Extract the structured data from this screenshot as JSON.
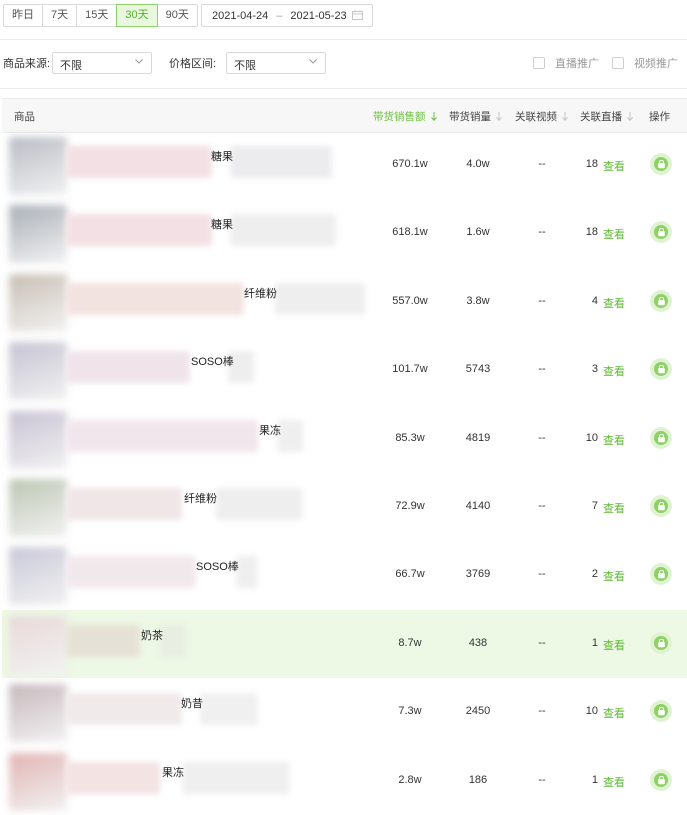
{
  "date_range": {
    "presets": [
      "昨日",
      "7天",
      "15天",
      "30天",
      "90天"
    ],
    "active_preset": "30天",
    "start": "2021-04-24",
    "separator": "–",
    "end": "2021-05-23"
  },
  "filters": {
    "source_label": "商品来源:",
    "source_value": "不限",
    "price_label": "价格区间:",
    "price_value": "不限",
    "live_promo": "直播推广",
    "video_promo": "视频推广"
  },
  "table": {
    "headers": {
      "product": "商品",
      "sales_amount": "带货销售额",
      "sales_volume": "带货销量",
      "related_videos": "关联视频",
      "related_live": "关联直播",
      "action": "操作"
    },
    "view_label": "查看",
    "rows": [
      {
        "keyword": "糖果",
        "sales_amount": "670.1w",
        "sales_volume": "4.0w",
        "related_videos": "--",
        "live_count": "18"
      },
      {
        "keyword": "糖果",
        "sales_amount": "618.1w",
        "sales_volume": "1.6w",
        "related_videos": "--",
        "live_count": "18"
      },
      {
        "keyword": "纤维粉",
        "sales_amount": "557.0w",
        "sales_volume": "3.8w",
        "related_videos": "--",
        "live_count": "4"
      },
      {
        "keyword": "SOSO棒",
        "sales_amount": "101.7w",
        "sales_volume": "5743",
        "related_videos": "--",
        "live_count": "3"
      },
      {
        "keyword": "果冻",
        "sales_amount": "85.3w",
        "sales_volume": "4819",
        "related_videos": "--",
        "live_count": "10"
      },
      {
        "keyword": "纤维粉",
        "sales_amount": "72.9w",
        "sales_volume": "4140",
        "related_videos": "--",
        "live_count": "7"
      },
      {
        "keyword": "SOSO棒",
        "sales_amount": "66.7w",
        "sales_volume": "3769",
        "related_videos": "--",
        "live_count": "2"
      },
      {
        "keyword": "奶茶",
        "sales_amount": "8.7w",
        "sales_volume": "438",
        "related_videos": "--",
        "live_count": "1"
      },
      {
        "keyword": "奶昔",
        "sales_amount": "7.3w",
        "sales_volume": "2450",
        "related_videos": "--",
        "live_count": "10"
      },
      {
        "keyword": "果冻",
        "sales_amount": "2.8w",
        "sales_volume": "186",
        "related_videos": "--",
        "live_count": "1"
      }
    ]
  },
  "colors": {
    "accent": "#6cc23c",
    "active_bg": "#e9f7df",
    "highlight_row": "#edf8e5",
    "link": "#5fb834"
  }
}
